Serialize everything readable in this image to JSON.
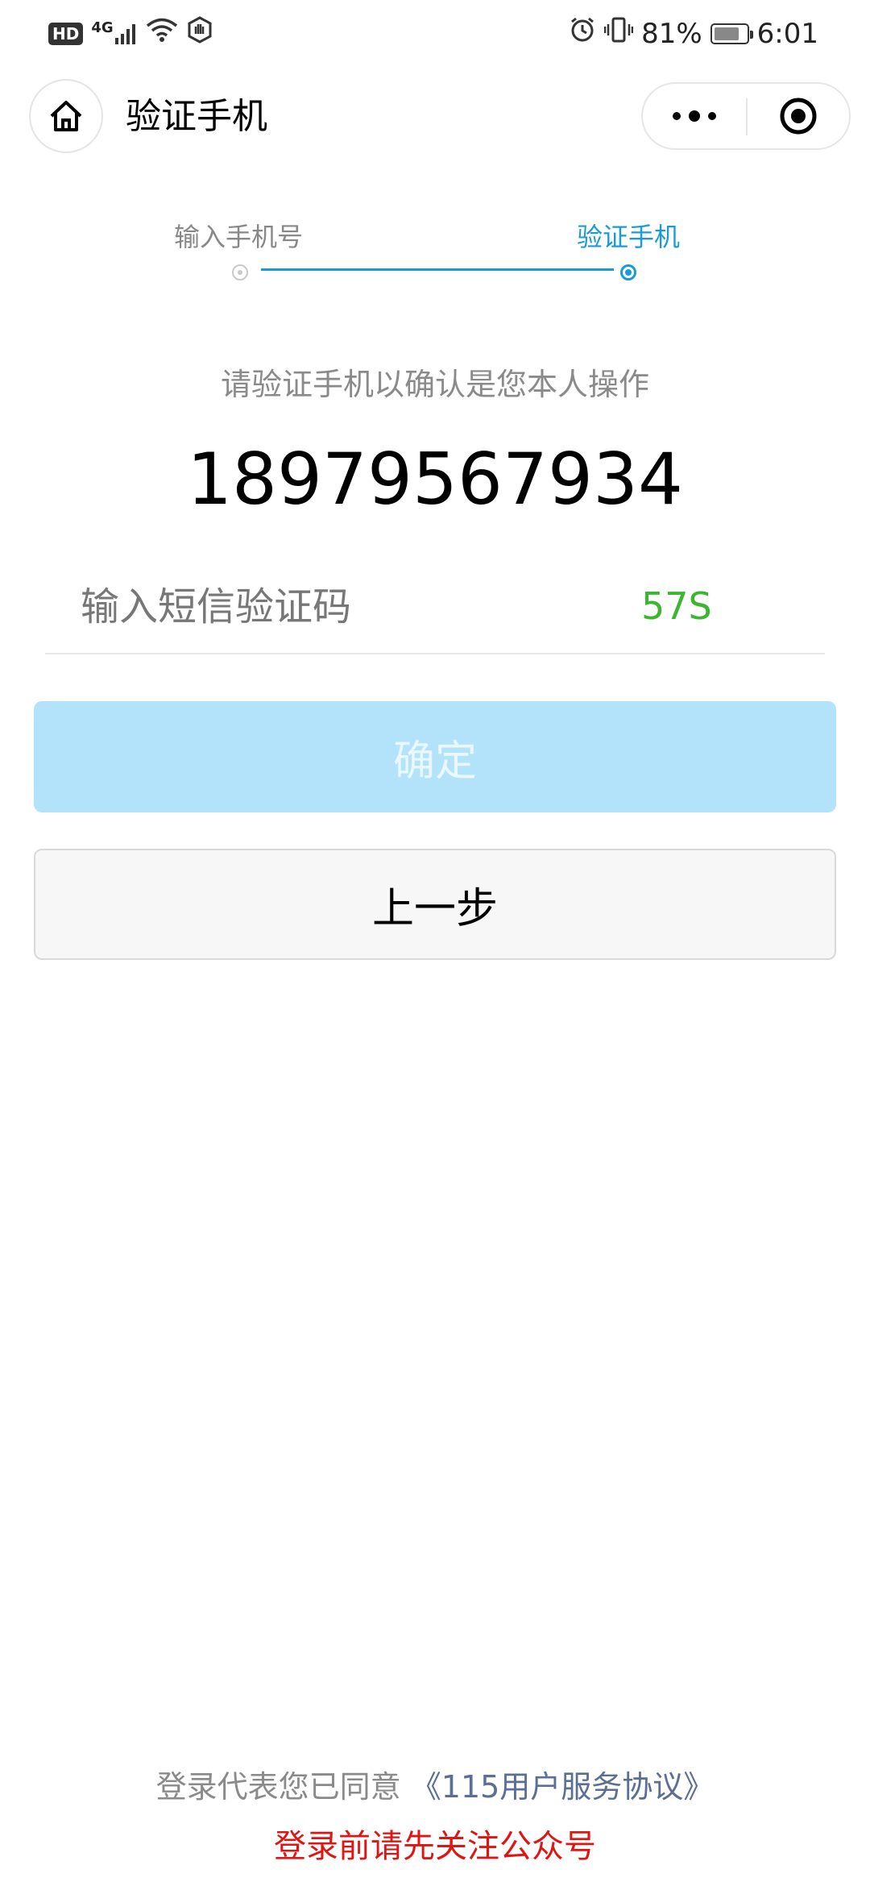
{
  "status_bar": {
    "hd_label": "HD",
    "network_label": "4G",
    "battery_percent": "81%",
    "time": "6:01"
  },
  "nav": {
    "title": "验证手机",
    "home_icon": "home-icon",
    "more_icon": "more-dots-icon",
    "close_icon": "target-close-icon"
  },
  "steps": {
    "step1_label": "输入手机号",
    "step2_label": "验证手机",
    "active_step": 2,
    "active_color": "#1a9bd7"
  },
  "verify": {
    "prompt": "请验证手机以确认是您本人操作",
    "phone_number": "18979567934",
    "code_placeholder": "输入短信验证码",
    "countdown": "57S"
  },
  "buttons": {
    "confirm_label": "确定",
    "back_label": "上一步"
  },
  "footer": {
    "agreement_prefix": "登录代表您已同意",
    "agreement_link": "《115用户服务协议》",
    "follow_notice": "登录前请先关注公众号"
  },
  "colors": {
    "accent": "#1a9bd7",
    "countdown": "#3cb531",
    "confirm_button_disabled": "#b3e3fa",
    "notice_red": "#e11414"
  }
}
